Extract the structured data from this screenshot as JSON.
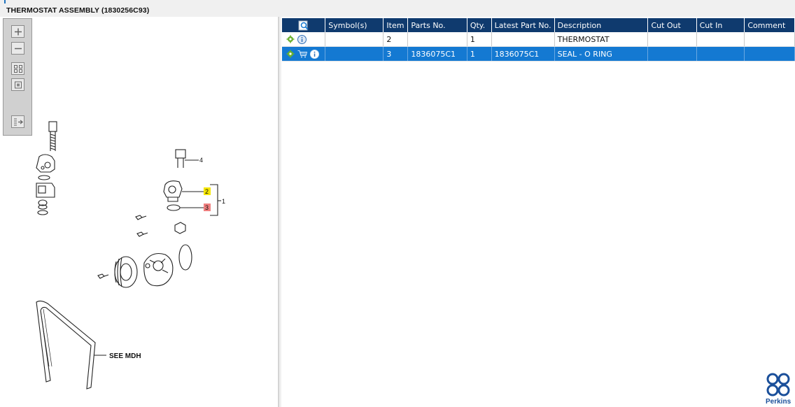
{
  "window": {
    "title": "THERMOSTAT ASSEMBLY (1830256C93)"
  },
  "viewer": {
    "tools": [
      {
        "name": "zoom-in-icon"
      },
      {
        "name": "zoom-out-icon"
      },
      {
        "name": "fit-all-icon"
      },
      {
        "name": "actual-size-icon"
      },
      {
        "name": "export-list-icon"
      }
    ],
    "callouts": {
      "bolt": "4",
      "thermostat": "2",
      "oring": "3",
      "assembly": "1"
    },
    "note": "SEE MDH"
  },
  "grid": {
    "columns": [
      "",
      "Symbol(s)",
      "Item",
      "Parts No.",
      "Qty.",
      "Latest Part No.",
      "Description",
      "Cut Out",
      "Cut In",
      "Comment"
    ],
    "rows": [
      {
        "icons": [
          "gear-icon",
          "info-icon"
        ],
        "symbols": "",
        "item": "2",
        "part_no": "",
        "qty": "1",
        "latest_part_no": "",
        "description": "THERMOSTAT",
        "cut_out": "",
        "cut_in": "",
        "comment": "",
        "selected": false
      },
      {
        "icons": [
          "gear-icon",
          "cart-icon",
          "info-icon"
        ],
        "symbols": "",
        "item": "3",
        "part_no": "1836075C1",
        "qty": "1",
        "latest_part_no": "1836075C1",
        "description": "SEAL - O RING",
        "cut_out": "",
        "cut_in": "",
        "comment": "",
        "selected": true
      }
    ]
  },
  "brand": {
    "name": "Perkins",
    "color": "#1a4f9a"
  },
  "colors": {
    "header": "#0f3a6e",
    "selection": "#1479d2",
    "callout_highlight": "#f5e600",
    "callout_selected": "#f08080"
  }
}
